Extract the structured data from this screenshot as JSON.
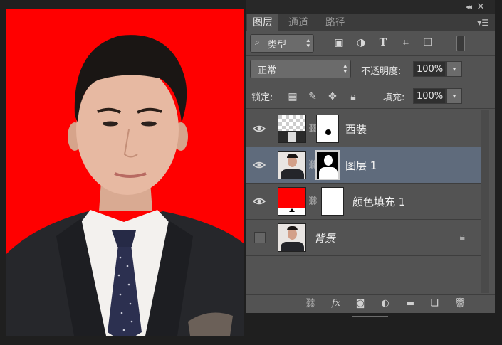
{
  "panel": {
    "tabs": [
      "图层",
      "通道",
      "路径"
    ],
    "active_tab": "图层",
    "filter": {
      "label": "类型",
      "icons": [
        "image-filter-icon",
        "adjustment-filter-icon",
        "type-filter-icon",
        "shape-filter-icon",
        "smart-object-filter-icon"
      ]
    },
    "blend_mode": "正常",
    "opacity": {
      "label": "不透明度:",
      "value": "100%"
    },
    "lock": {
      "label": "锁定:",
      "icons": [
        "lock-transparent-icon",
        "lock-paint-icon",
        "lock-move-icon",
        "lock-all-icon"
      ]
    },
    "fill": {
      "label": "填充:",
      "value": "100%"
    },
    "layers": [
      {
        "name": "西装",
        "visible": true,
        "selected": false,
        "locked": false
      },
      {
        "name": "图层 1",
        "visible": true,
        "selected": true,
        "locked": false
      },
      {
        "name": "颜色填充 1",
        "visible": true,
        "selected": false,
        "locked": false
      },
      {
        "name": "背景",
        "visible": false,
        "selected": false,
        "locked": true
      }
    ],
    "bottom_icons": [
      "link-layers-icon",
      "fx-icon",
      "add-mask-icon",
      "adjustment-layer-icon",
      "group-folder-icon",
      "new-layer-icon",
      "delete-layer-icon"
    ]
  },
  "colors": {
    "canvas_background": "#ff0000",
    "fill_layer_color": "#ff0000",
    "selected_row": "#5f6b7c",
    "panel_bg": "#535353"
  }
}
